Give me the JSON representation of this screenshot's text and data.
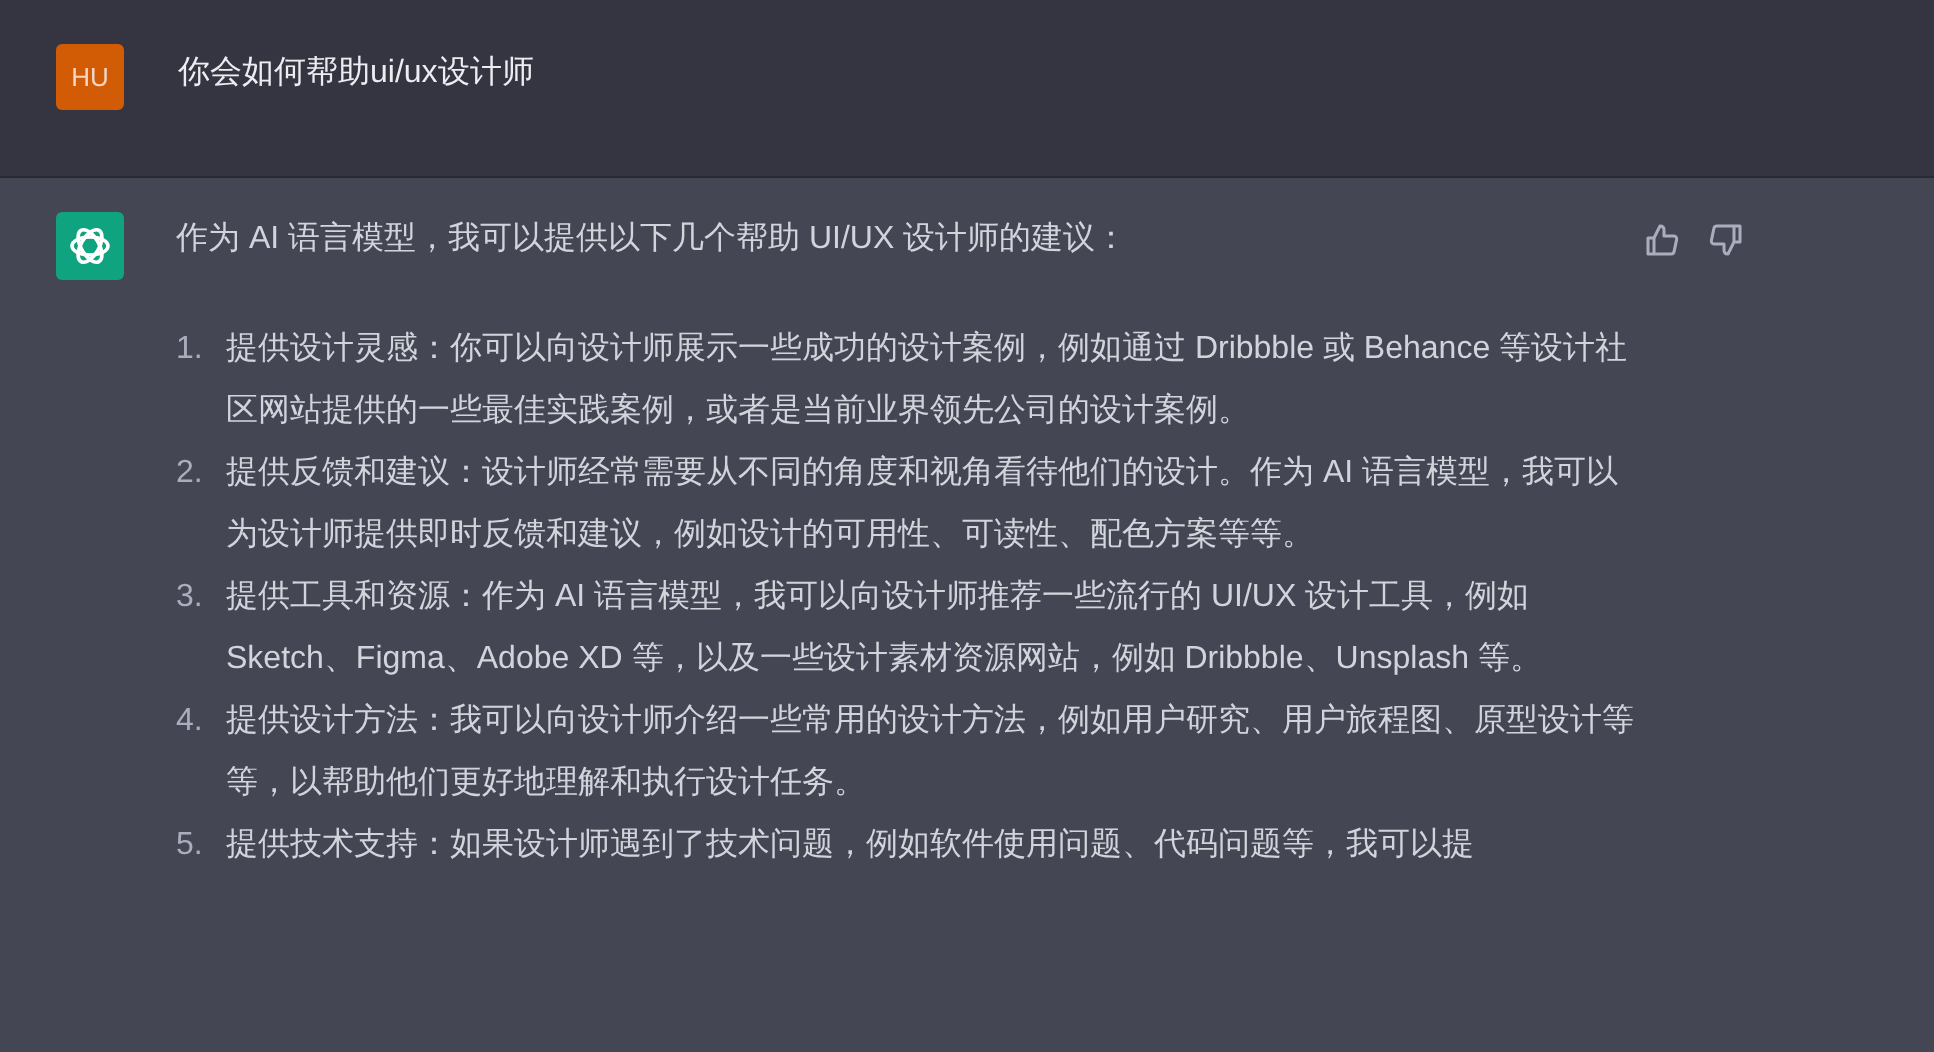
{
  "user_message": {
    "avatar": "HU",
    "text": "你会如何帮助ui/ux设计师"
  },
  "assistant_message": {
    "intro": "作为 AI 语言模型，我可以提供以下几个帮助 UI/UX 设计师的建议：",
    "items": [
      {
        "number": "1.",
        "text": "提供设计灵感：你可以向设计师展示一些成功的设计案例，例如通过 Dribbble 或 Behance 等设计社区网站提供的一些最佳实践案例，或者是当前业界领先公司的设计案例。"
      },
      {
        "number": "2.",
        "text": "提供反馈和建议：设计师经常需要从不同的角度和视角看待他们的设计。作为 AI 语言模型，我可以为设计师提供即时反馈和建议，例如设计的可用性、可读性、配色方案等等。"
      },
      {
        "number": "3.",
        "text": "提供工具和资源：作为 AI 语言模型，我可以向设计师推荐一些流行的 UI/UX 设计工具，例如 Sketch、Figma、Adobe XD 等，以及一些设计素材资源网站，例如 Dribbble、Unsplash 等。"
      },
      {
        "number": "4.",
        "text": "提供设计方法：我可以向设计师介绍一些常用的设计方法，例如用户研究、用户旅程图、原型设计等等，以帮助他们更好地理解和执行设计任务。"
      },
      {
        "number": "5.",
        "text": "提供技术支持：如果设计师遇到了技术问题，例如软件使用问题、代码问题等，我可以提"
      }
    ]
  }
}
